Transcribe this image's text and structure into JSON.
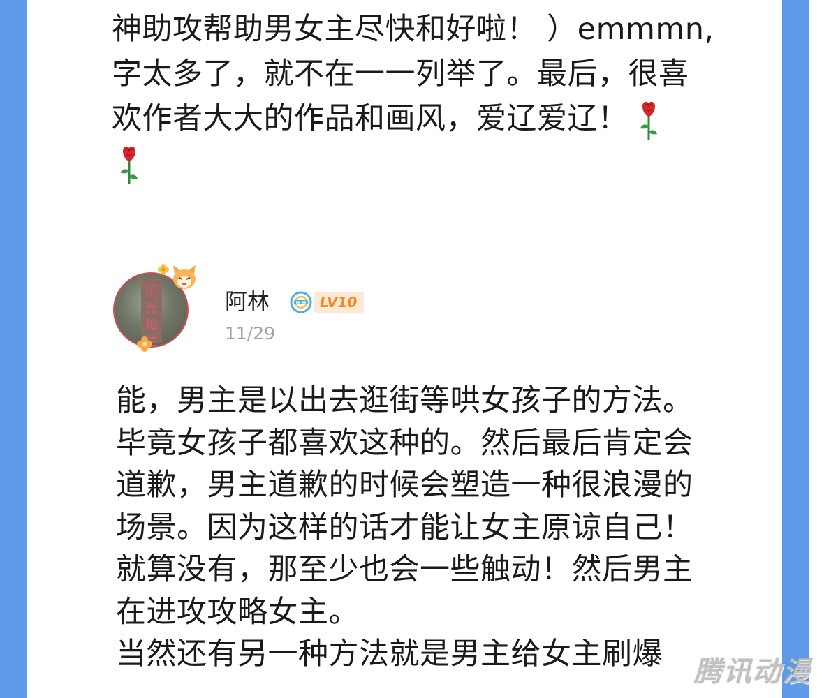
{
  "previous_comment": {
    "lines": [
      "神助攻帮助男女主尽快和好啦！ ）emmmn,",
      "字太多了，就不在一一列举了。最后，很喜",
      "欢作者大大的作品和画风，爱辽爱辽！"
    ]
  },
  "comment": {
    "username": "阿林",
    "level": "LV10",
    "date": "11/29",
    "avatar_text": "阳光灿烂",
    "lines": [
      "能，男主是以出去逛街等哄女孩子的方法。",
      "毕竟女孩子都喜欢这种的。然后最后肯定会",
      "道歉，男主道歉的时候会塑造一种很浪漫的",
      "场景。因为这样的话才能让女主原谅自己！",
      "就算没有，那至少也会一些触动！然后男主",
      "在进攻攻略女主。",
      "当然还有另一种方法就是男主给女主刷爆"
    ]
  },
  "watermark": "腾讯动漫",
  "icons": {
    "rose": "rose-emoji-icon",
    "level": "level-emblem-icon"
  },
  "colors": {
    "side_bar": "#5d9be8",
    "level_text": "#f08a23",
    "level_bg": "#fde9d5",
    "date": "#a3a3a3"
  }
}
